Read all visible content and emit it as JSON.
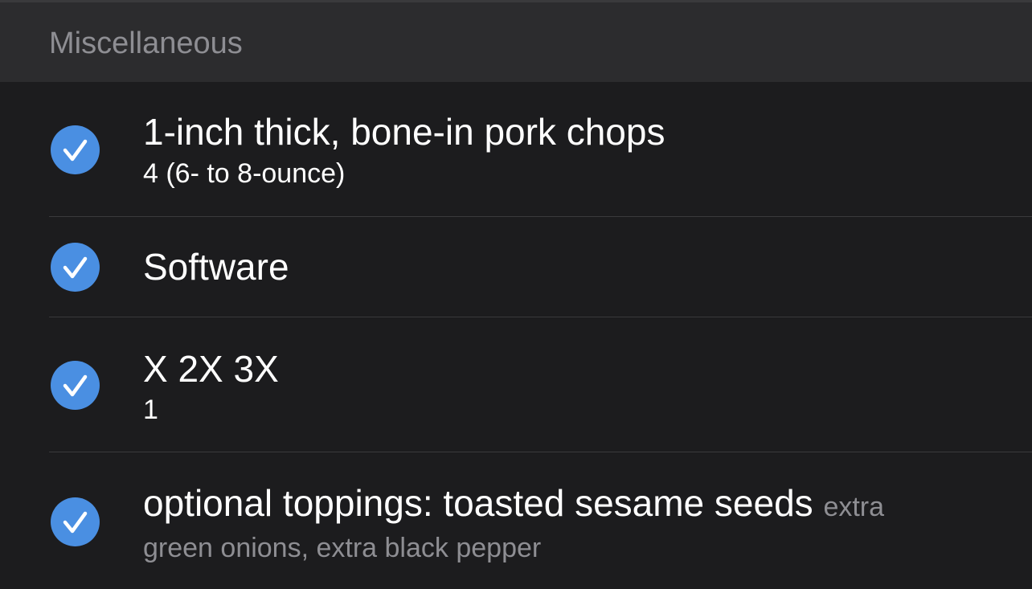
{
  "section": {
    "title": "Miscellaneous"
  },
  "items": [
    {
      "title": "1-inch thick, bone-in pork chops",
      "quantity": "4 (6- to 8-ounce)",
      "checked": true
    },
    {
      "title": "Software",
      "checked": true
    },
    {
      "title": "X 2X 3X",
      "quantity": "1",
      "checked": true
    },
    {
      "title": "optional toppings: toasted sesame seeds",
      "note_inline": "extra",
      "note_line2": "green onions, extra black pepper",
      "checked": true
    }
  ],
  "colors": {
    "background": "#1c1c1e",
    "header_background": "#2c2c2e",
    "accent": "#4a8fe2",
    "secondary_text": "#8e8e93",
    "primary_text": "#ffffff"
  },
  "icons": {
    "check": "checkmark-circle-icon"
  }
}
